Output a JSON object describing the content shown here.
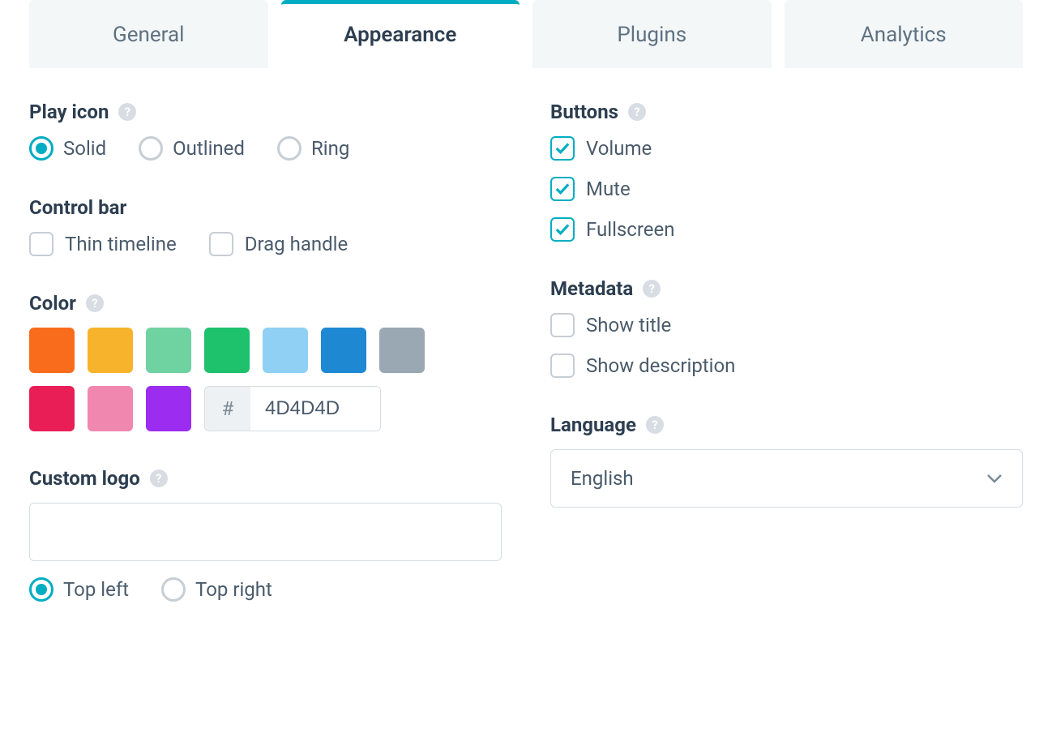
{
  "tabs": {
    "general": "General",
    "appearance": "Appearance",
    "plugins": "Plugins",
    "analytics": "Analytics"
  },
  "playIcon": {
    "title": "Play icon",
    "options": {
      "solid": "Solid",
      "outlined": "Outlined",
      "ring": "Ring"
    }
  },
  "controlBar": {
    "title": "Control bar",
    "thinTimeline": "Thin timeline",
    "dragHandle": "Drag handle"
  },
  "color": {
    "title": "Color",
    "hashSymbol": "#",
    "hex": "4D4D4D",
    "swatches": [
      "#f96c1c",
      "#f7b32b",
      "#6fd3a1",
      "#1ec16c",
      "#8fd0f4",
      "#1e88d2",
      "#9aa8b4",
      "#e91e57",
      "#f087af",
      "#9b2cf0"
    ]
  },
  "customLogo": {
    "title": "Custom logo",
    "value": "",
    "positions": {
      "topLeft": "Top left",
      "topRight": "Top right"
    }
  },
  "buttons": {
    "title": "Buttons",
    "volume": "Volume",
    "mute": "Mute",
    "fullscreen": "Fullscreen"
  },
  "metadata": {
    "title": "Metadata",
    "showTitle": "Show title",
    "showDescription": "Show description"
  },
  "language": {
    "title": "Language",
    "value": "English"
  }
}
